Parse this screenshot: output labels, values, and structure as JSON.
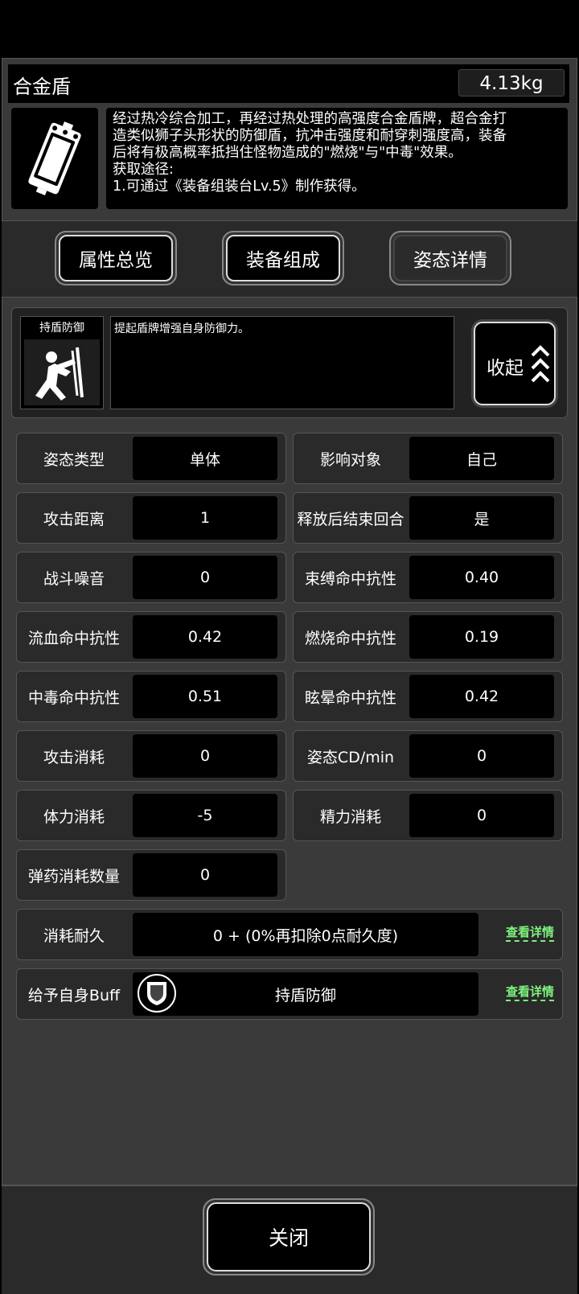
{
  "item": {
    "name": "合金盾",
    "weight": "4.13kg",
    "description_lines": [
      "经过热冷综合加工，再经过热处理的高强度合金盾牌，超合金打",
      "造类似狮子头形状的防御盾，抗冲击强度和耐穿刺强度高，装备",
      "后将有极高概率抵挡住怪物造成的\"燃烧\"与\"中毒\"效果。",
      "获取途径:",
      "1.可通过《装备组装台Lv.5》制作获得。"
    ],
    "icon": "shield-item-icon"
  },
  "tabs": [
    {
      "label": "属性总览"
    },
    {
      "label": "装备组成"
    },
    {
      "label": "姿态详情",
      "active": true
    }
  ],
  "stance": {
    "name": "持盾防御",
    "description": "提起盾牌增强自身防御力。",
    "icon": "shield-stance-icon",
    "collapse_label": "收起"
  },
  "stats": [
    {
      "label": "姿态类型",
      "value": "单体"
    },
    {
      "label": "影响对象",
      "value": "自己"
    },
    {
      "label": "攻击距离",
      "value": "1"
    },
    {
      "label": "释放后结束回合",
      "value": "是"
    },
    {
      "label": "战斗噪音",
      "value": "0"
    },
    {
      "label": "束缚命中抗性",
      "value": "0.40"
    },
    {
      "label": "流血命中抗性",
      "value": "0.42"
    },
    {
      "label": "燃烧命中抗性",
      "value": "0.19"
    },
    {
      "label": "中毒命中抗性",
      "value": "0.51"
    },
    {
      "label": "眩晕命中抗性",
      "value": "0.42"
    },
    {
      "label": "攻击消耗",
      "value": "0"
    },
    {
      "label": "姿态CD/min",
      "value": "0"
    },
    {
      "label": "体力消耗",
      "value": "-5"
    },
    {
      "label": "精力消耗",
      "value": "0"
    },
    {
      "label": "弹药消耗数量",
      "value": "0"
    }
  ],
  "durability": {
    "label": "消耗耐久",
    "value": "0 + (0%再扣除0点耐久度)",
    "link": "查看详情"
  },
  "buff": {
    "label": "给予自身Buff",
    "value": "持盾防御",
    "icon": "shield-buff-icon",
    "link": "查看详情"
  },
  "close_label": "关闭"
}
